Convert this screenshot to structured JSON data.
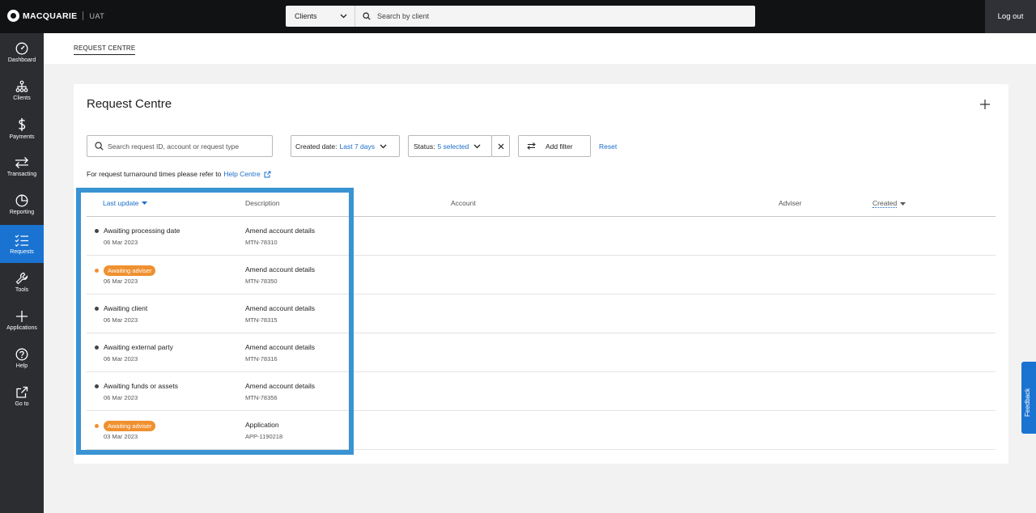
{
  "header": {
    "brand": "MACQUARIE",
    "environment": "UAT",
    "search_scope": "Clients",
    "search_placeholder": "Search by client",
    "logout_label": "Log out"
  },
  "sidebar": {
    "items": [
      {
        "label": "Dashboard",
        "icon": "gauge-icon"
      },
      {
        "label": "Clients",
        "icon": "org-chart-icon"
      },
      {
        "label": "Payments",
        "icon": "dollar-icon"
      },
      {
        "label": "Transacting",
        "icon": "swap-arrows-icon"
      },
      {
        "label": "Reporting",
        "icon": "pie-chart-icon"
      },
      {
        "label": "Requests",
        "icon": "checklist-icon",
        "active": true
      },
      {
        "label": "Tools",
        "icon": "wrench-icon"
      },
      {
        "label": "Applications",
        "icon": "plus-icon"
      },
      {
        "label": "Help",
        "icon": "question-icon"
      },
      {
        "label": "Go to",
        "icon": "external-link-icon"
      }
    ]
  },
  "breadcrumb": "REQUEST CENTRE",
  "card": {
    "title": "Request Centre",
    "search_placeholder": "Search request ID, account or request type",
    "date_filter_label": "Created date:",
    "date_filter_value": "Last 7 days",
    "status_filter_label": "Status:",
    "status_filter_value": "5 selected",
    "add_filter_label": "Add filter",
    "reset_label": "Reset",
    "turnaround_text": "For request turnaround times please refer to",
    "help_link": "Help Centre"
  },
  "table": {
    "columns": {
      "last_update": "Last update",
      "description": "Description",
      "account": "Account",
      "adviser": "Adviser",
      "created": "Created"
    },
    "rows": [
      {
        "status": "Awaiting processing date",
        "badge": false,
        "date": "06 Mar 2023",
        "description": "Amend account details",
        "ref": "MTN-78310"
      },
      {
        "status": "Awaiting adviser",
        "badge": true,
        "date": "06 Mar 2023",
        "description": "Amend account details",
        "ref": "MTN-78350"
      },
      {
        "status": "Awaiting client",
        "badge": false,
        "date": "06 Mar 2023",
        "description": "Amend account details",
        "ref": "MTN-78315"
      },
      {
        "status": "Awaiting external party",
        "badge": false,
        "date": "06 Mar 2023",
        "description": "Amend account details",
        "ref": "MTN-78316"
      },
      {
        "status": "Awaiting funds or assets",
        "badge": false,
        "date": "06 Mar 2023",
        "description": "Amend account details",
        "ref": "MTN-78356"
      },
      {
        "status": "Awaiting adviser",
        "badge": true,
        "date": "03 Mar 2023",
        "description": "Application",
        "ref": "APP-1190218"
      }
    ]
  },
  "feedback_label": "Feedback",
  "colors": {
    "accent": "#1a73d1",
    "link": "#1a6dc9",
    "badge": "#f0902f",
    "highlight": "#3a93d3",
    "topbar": "#111214",
    "sidebar": "#2b2d31"
  }
}
